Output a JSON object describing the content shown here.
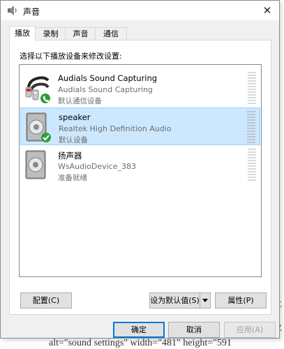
{
  "window": {
    "title": "声音",
    "close_glyph": "✕"
  },
  "tabs": [
    {
      "label": "播放",
      "active": true
    },
    {
      "label": "录制",
      "active": false
    },
    {
      "label": "声音",
      "active": false
    },
    {
      "label": "通信",
      "active": false
    }
  ],
  "panel": {
    "instruction": "选择以下播放设备来修改设置:"
  },
  "devices": [
    {
      "name": "Audials Sound Capturing",
      "description": "Audials Sound Capturing",
      "status": "默认通信设备",
      "icon": "rca-cable-icon",
      "badge": "phone-badge-icon",
      "selected": false
    },
    {
      "name": "speaker",
      "description": "Realtek High Definition Audio",
      "status": "默认设备",
      "icon": "speaker-icon",
      "badge": "check-badge-icon",
      "selected": true
    },
    {
      "name": "扬声器",
      "description": "WsAudioDevice_383",
      "status": "准备就绪",
      "icon": "speaker-icon",
      "badge": "",
      "selected": false
    }
  ],
  "buttons": {
    "configure": "配置(C)",
    "set_default": "设为默认值(S)",
    "properties": "属性(P)",
    "ok": "确定",
    "cancel": "取消",
    "apply": "应用(A)"
  },
  "background": {
    "bottom_text": "alt=\"sound settings\" width=\"481\" height=\"591",
    "right_c": "C",
    "right_z": "Z"
  },
  "colors": {
    "selection": "#cce8ff",
    "primary_border": "#0078d7",
    "check_badge": "#2e9e3e",
    "phone_badge": "#2e9e3e"
  }
}
